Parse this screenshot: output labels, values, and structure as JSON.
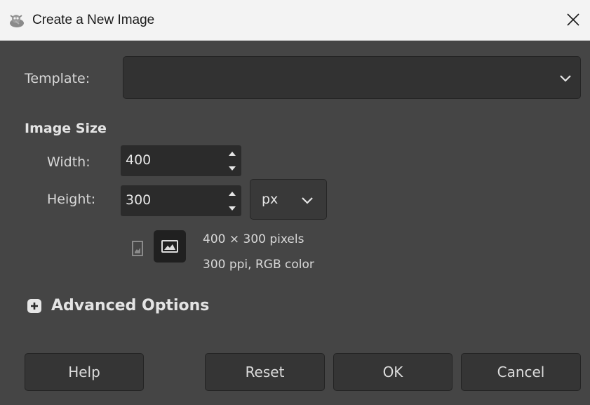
{
  "window": {
    "title": "Create a New Image"
  },
  "template": {
    "label": "Template:",
    "value": ""
  },
  "image_size": {
    "heading": "Image Size",
    "width_label": "Width:",
    "width_value": "400",
    "height_label": "Height:",
    "height_value": "300",
    "unit": "px"
  },
  "info": {
    "dimensions": "400 × 300 pixels",
    "resolution": "300 ppi, RGB color"
  },
  "advanced": {
    "label": "Advanced Options"
  },
  "buttons": {
    "help": "Help",
    "reset": "Reset",
    "ok": "OK",
    "cancel": "Cancel"
  },
  "colors": {
    "background": "#454545",
    "field": "#2b2b2b",
    "titlebar": "#f3f3f3",
    "text": "#dcdcdc"
  },
  "icons": [
    "gimp-app-icon",
    "close-icon",
    "chevron-down-icon",
    "spin-up-icon",
    "spin-down-icon",
    "portrait-icon",
    "landscape-icon",
    "expander-plus-icon"
  ]
}
